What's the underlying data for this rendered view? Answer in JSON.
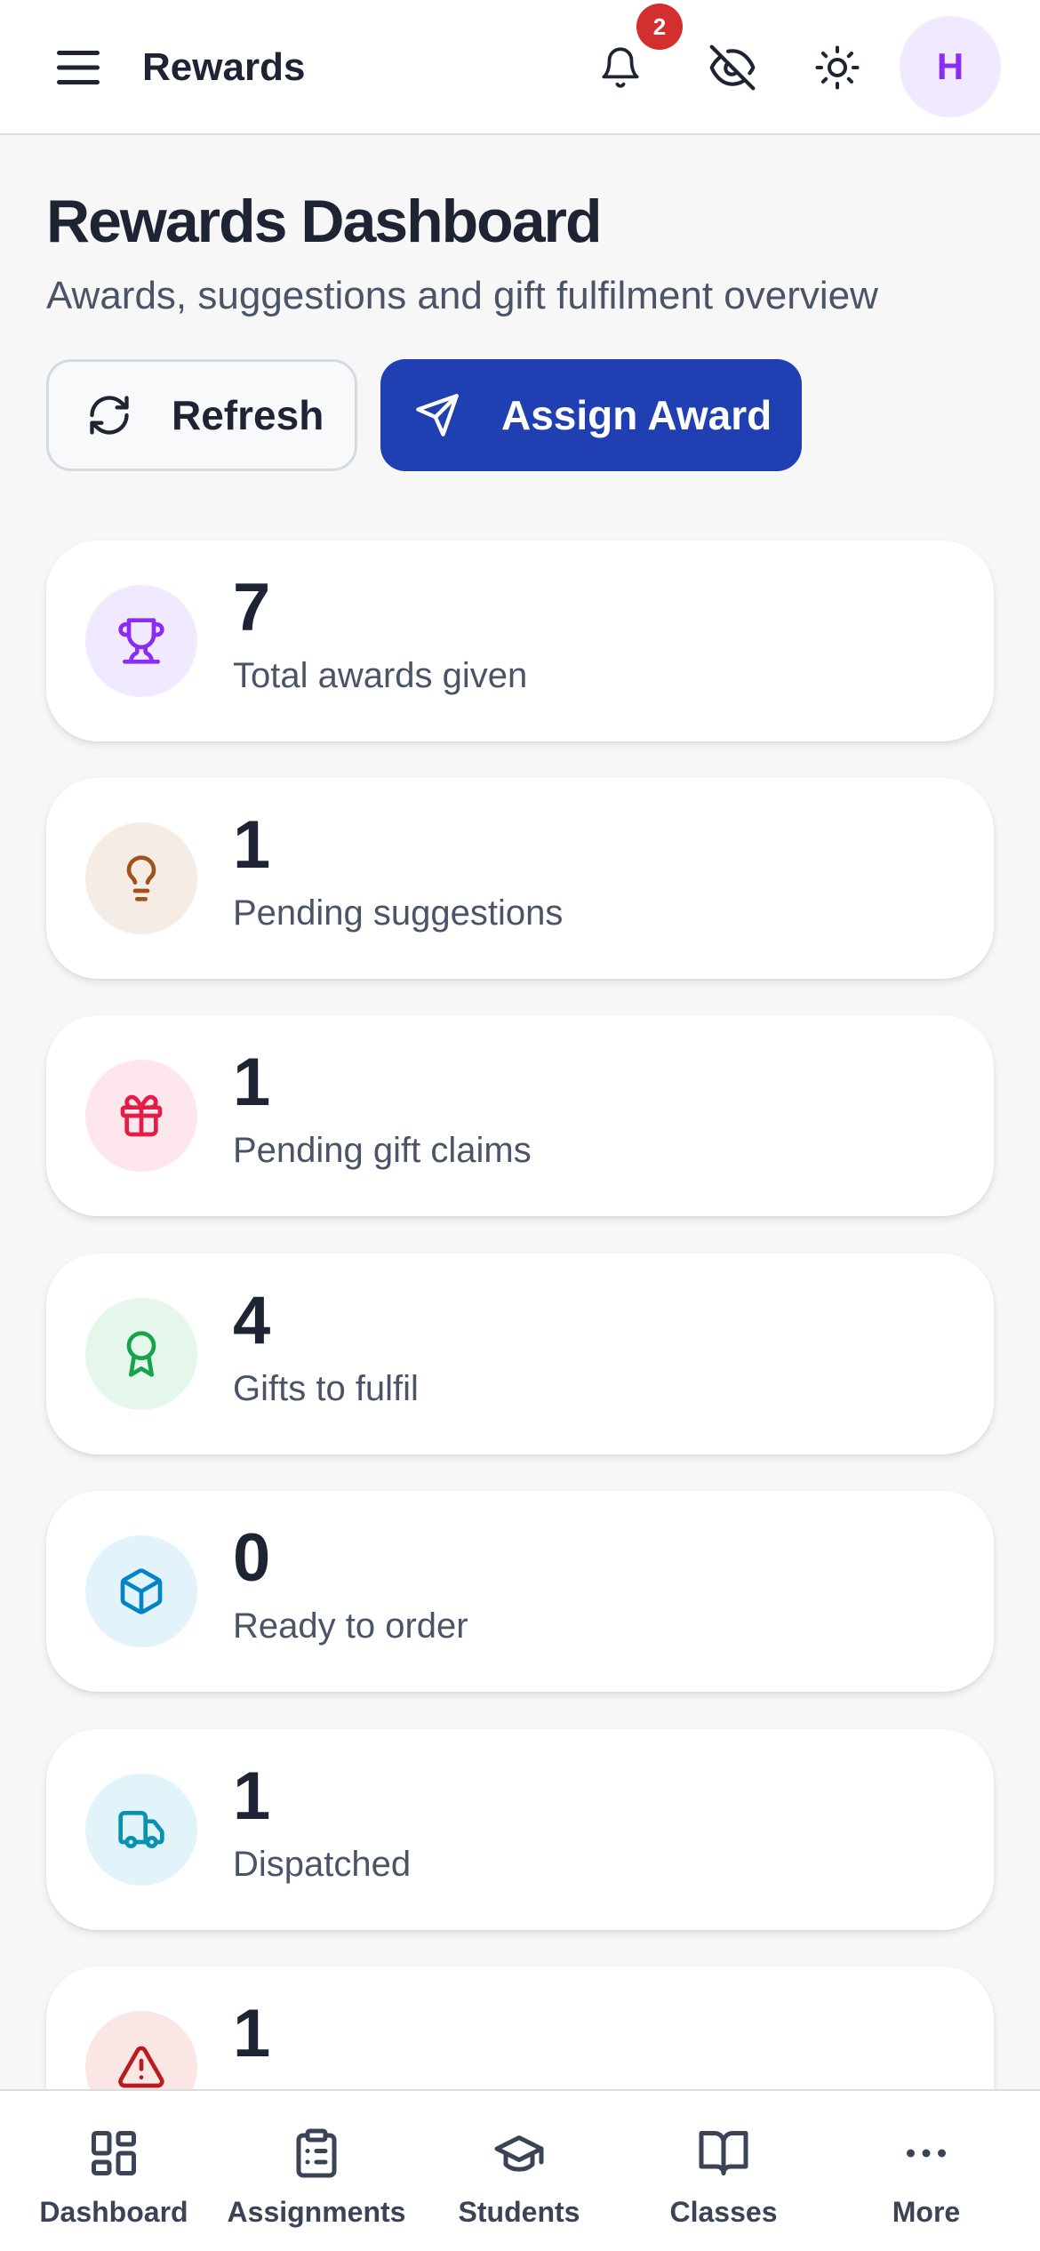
{
  "header": {
    "title": "Rewards",
    "notification_count": "2",
    "avatar_initial": "H"
  },
  "page": {
    "title": "Rewards Dashboard",
    "subtitle": "Awards, suggestions and gift fulfilment overview",
    "refresh_label": "Refresh",
    "assign_label": "Assign Award"
  },
  "stats": [
    {
      "value": "7",
      "label": "Total awards given",
      "icon": "trophy-icon",
      "color": "#8b2cf5",
      "bg": "#f1e9ff"
    },
    {
      "value": "1",
      "label": "Pending suggestions",
      "icon": "lightbulb-icon",
      "color": "#a0521d",
      "bg": "#f6ece6"
    },
    {
      "value": "1",
      "label": "Pending gift claims",
      "icon": "gift-icon",
      "color": "#e11d48",
      "bg": "#fde7ec"
    },
    {
      "value": "4",
      "label": "Gifts to fulfil",
      "icon": "award-ribbon-icon",
      "color": "#16a34a",
      "bg": "#e5f6ea"
    },
    {
      "value": "0",
      "label": "Ready to order",
      "icon": "box-icon",
      "color": "#0284c7",
      "bg": "#e3f3fb"
    },
    {
      "value": "1",
      "label": "Dispatched",
      "icon": "truck-icon",
      "color": "#0891b2",
      "bg": "#e1f4f9"
    },
    {
      "value": "1",
      "label": "",
      "icon": "warning-icon",
      "color": "#b91c1c",
      "bg": "#fbe6e6"
    }
  ],
  "bottom_nav": [
    {
      "label": "Dashboard",
      "icon": "dashboard-grid-icon"
    },
    {
      "label": "Assignments",
      "icon": "clipboard-list-icon"
    },
    {
      "label": "Students",
      "icon": "graduation-cap-icon"
    },
    {
      "label": "Classes",
      "icon": "open-book-icon"
    },
    {
      "label": "More",
      "icon": "more-dots-icon"
    }
  ]
}
